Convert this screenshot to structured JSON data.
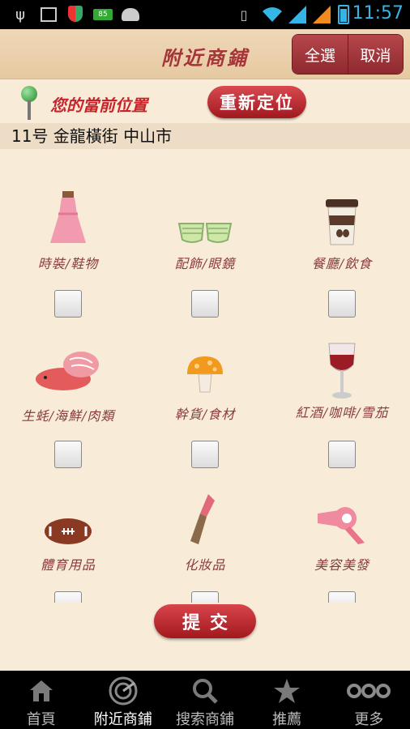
{
  "status_bar": {
    "time": "11:57",
    "battery_badge": "85",
    "icons": [
      "usb-icon",
      "image-icon",
      "shield-icon",
      "battery-badge-icon",
      "android-icon",
      "vibrate-icon",
      "wifi-icon",
      "signal-icon",
      "signal-icon",
      "battery-icon"
    ]
  },
  "header": {
    "title": "附近商鋪",
    "select_all_label": "全選",
    "cancel_label": "取消"
  },
  "location": {
    "label": "您的當前位置",
    "relocate_label": "重新定位",
    "address": "11号 金龍橫街 中山市"
  },
  "categories": [
    {
      "label": "時裝/鞋物",
      "icon": "dress-icon",
      "checked": false
    },
    {
      "label": "配飾/眼鏡",
      "icon": "glasses-icon",
      "checked": false
    },
    {
      "label": "餐廳/飲食",
      "icon": "coffee-cup-icon",
      "checked": false
    },
    {
      "label": "生蚝/海鮮/肉類",
      "icon": "meat-icon",
      "checked": false
    },
    {
      "label": "幹貨/食材",
      "icon": "mushroom-icon",
      "checked": false
    },
    {
      "label": "紅酒/咖啡/雪茄",
      "icon": "wine-glass-icon",
      "checked": false
    },
    {
      "label": "體育用品",
      "icon": "football-icon",
      "checked": false
    },
    {
      "label": "化妝品",
      "icon": "lipstick-icon",
      "checked": false
    },
    {
      "label": "美容美發",
      "icon": "hair-dryer-icon",
      "checked": false
    }
  ],
  "submit_label": "提交",
  "bottom_nav": [
    {
      "label": "首頁",
      "icon": "home-icon",
      "active": false
    },
    {
      "label": "附近商鋪",
      "icon": "radar-icon",
      "active": true
    },
    {
      "label": "搜索商鋪",
      "icon": "search-icon",
      "active": false
    },
    {
      "label": "推薦",
      "icon": "star-icon",
      "active": false
    },
    {
      "label": "更多",
      "icon": "more-icon",
      "active": false
    }
  ],
  "colors": {
    "background": "#f8ecd9",
    "accent_red": "#a6353a",
    "status_blue": "#35b5e5"
  }
}
